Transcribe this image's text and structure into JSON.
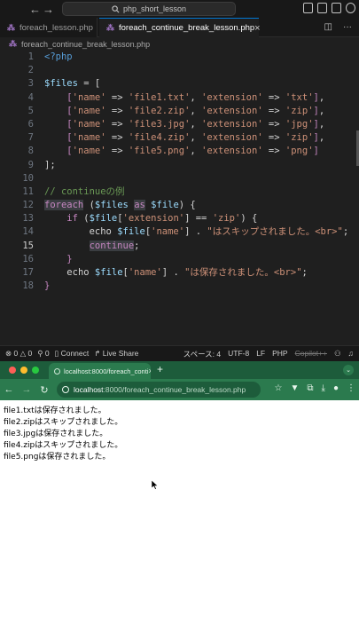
{
  "vscode": {
    "command_center": "php_short_lesson",
    "tabs": [
      {
        "label": "foreach_lesson.php"
      },
      {
        "label": "foreach_continue_break_lesson.php",
        "close": "×"
      }
    ],
    "breadcrumb": "foreach_continue_break_lesson.php",
    "line_numbers": [
      "1",
      "2",
      "3",
      "4",
      "5",
      "6",
      "7",
      "8",
      "9",
      "10",
      "11",
      "12",
      "13",
      "14",
      "15",
      "16",
      "17",
      "18"
    ],
    "code": {
      "l1_tag": "<?php",
      "l3_var": "$files",
      "l3_rest": " = [",
      "rows": [
        {
          "file": "'file1.txt'",
          "ext": "'txt'"
        },
        {
          "file": "'file2.zip'",
          "ext": "'zip'"
        },
        {
          "file": "'file3.jpg'",
          "ext": "'jpg'"
        },
        {
          "file": "'file4.zip'",
          "ext": "'zip'"
        },
        {
          "file": "'file5.png'",
          "ext": "'png'"
        }
      ],
      "key_name": "'name'",
      "key_ext": "'extension'",
      "arrow": " => ",
      "l9": "];",
      "l11_comment": "// continueの例",
      "l12_kw": "foreach",
      "l12_var": "$files",
      "l12_as": "as",
      "l12_var2": "$file",
      "l13_kw": "if",
      "l13_var": "$file",
      "l13_key": "'extension'",
      "l13_op": "] == ",
      "l13_val": "'zip'",
      "l14_echo": "echo",
      "l14_var": "$file",
      "l14_key": "'name'",
      "l14_str": "\"はスキップされました。<br>\"",
      "l15_kw": "continue",
      "l16": "}",
      "l17_echo": "echo",
      "l17_var": "$file",
      "l17_key": "'name'",
      "l17_str": "\"は保存されました。<br>\"",
      "l18": "}"
    },
    "status": {
      "errors": "0",
      "warnings": "0",
      "ports": "0",
      "connect": "Connect",
      "live_share": "Live Share",
      "spaces": "スペース: 4",
      "encoding": "UTF-8",
      "eol": "LF",
      "language": "PHP",
      "copilot": "Copilot++"
    }
  },
  "browser": {
    "tab_title": "localhost:8000/foreach_conti",
    "tab_close": "×",
    "new_tab": "+",
    "url_host": "localhost",
    "url_path": ":8000/foreach_continue_break_lesson.php",
    "output_lines": [
      "file1.txtは保存されました。",
      "file2.zipはスキップされました。",
      "file3.jpgは保存されました。",
      "file4.zipはスキップされました。",
      "file5.pngは保存されました。"
    ]
  },
  "colors": {
    "browser_frame": "#2b7a4e",
    "editor_bg": "#1f1f1f",
    "accent": "#0078d4"
  }
}
